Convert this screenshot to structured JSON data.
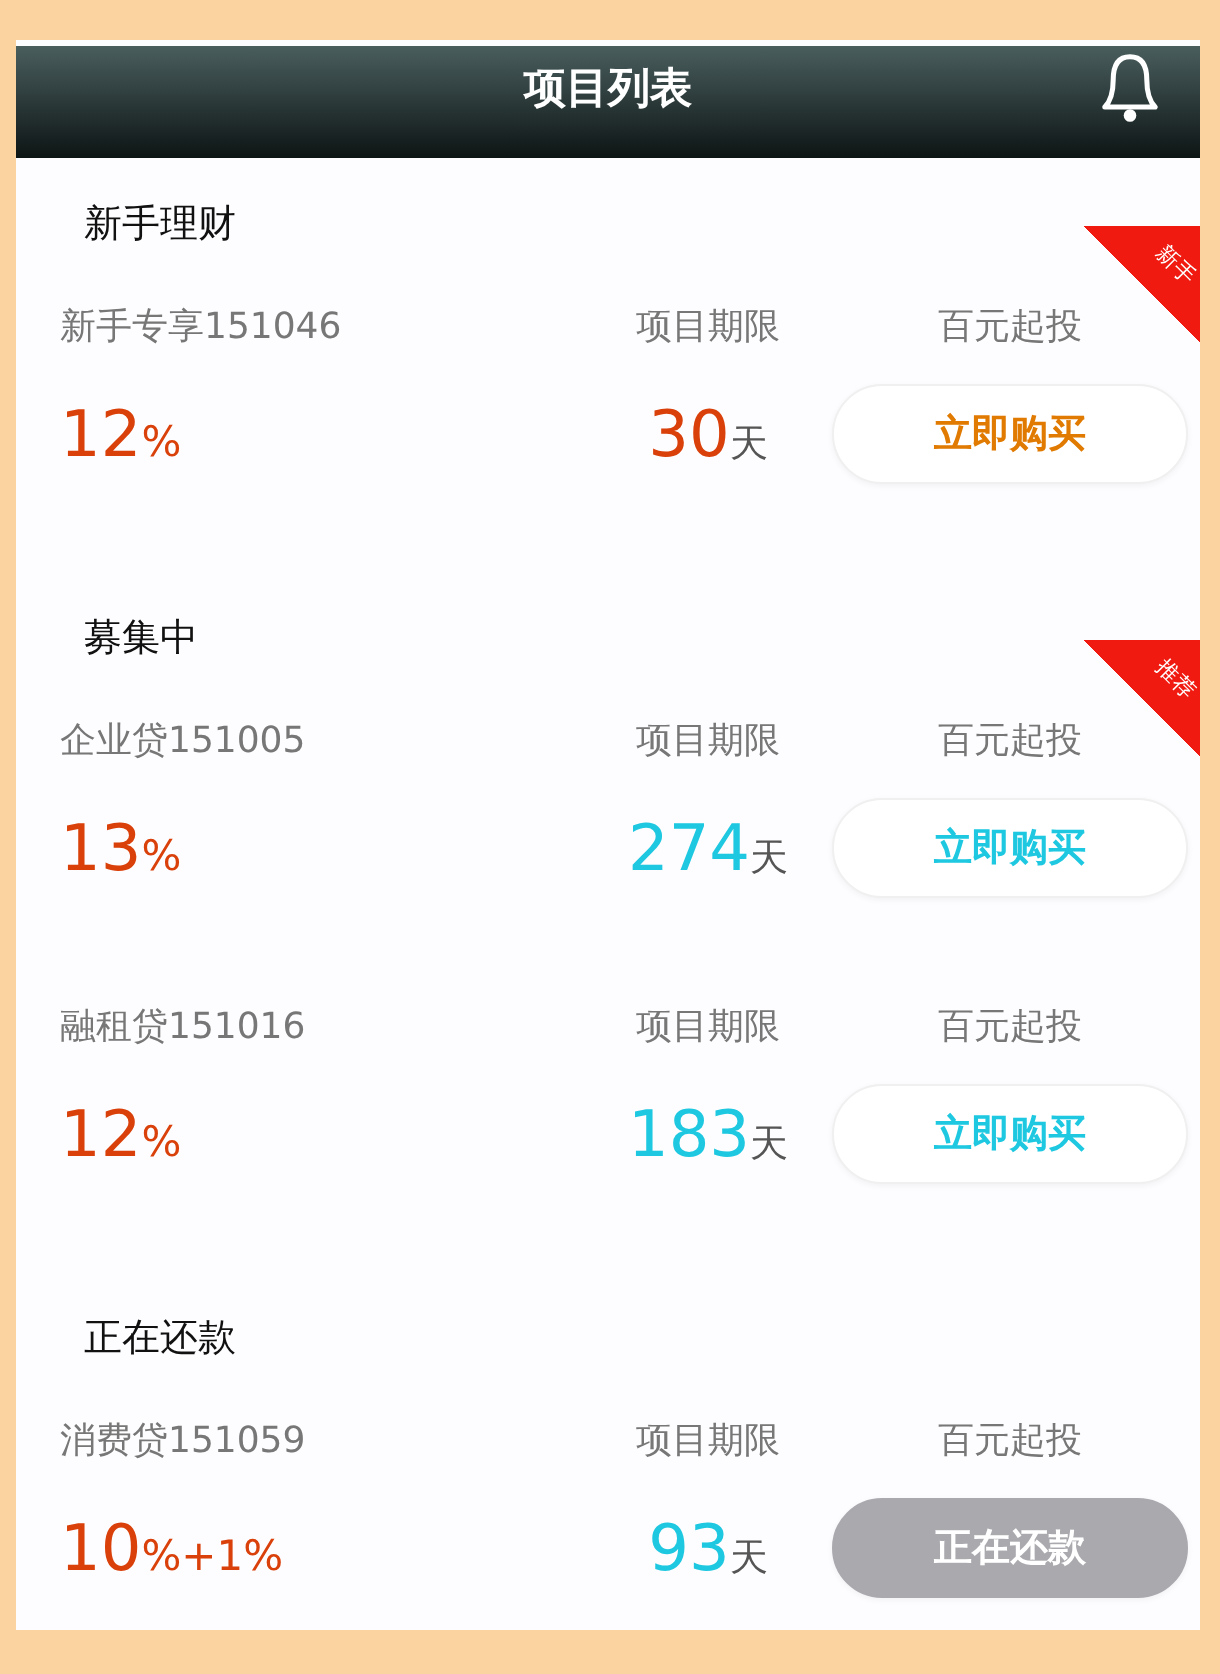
{
  "header": {
    "title": "项目列表"
  },
  "sections": [
    {
      "title": "新手理财",
      "items": [
        {
          "kind": "newbie",
          "name": "新手专享151046",
          "term_label": "项目期限",
          "min_label": "百元起投",
          "rate": "12",
          "rate_unit": "%",
          "days": "30",
          "days_unit": "天",
          "button": "立即购买",
          "disabled": false,
          "ribbon": "新手"
        }
      ]
    },
    {
      "title": "募集中",
      "items": [
        {
          "kind": "normal",
          "name": "企业贷151005",
          "term_label": "项目期限",
          "min_label": "百元起投",
          "rate": "13",
          "rate_unit": "%",
          "days": "274",
          "days_unit": "天",
          "button": "立即购买",
          "disabled": false,
          "ribbon": "推荐"
        },
        {
          "kind": "normal",
          "name": "融租贷151016",
          "term_label": "项目期限",
          "min_label": "百元起投",
          "rate": "12",
          "rate_unit": "%",
          "days": "183",
          "days_unit": "天",
          "button": "立即购买",
          "disabled": false
        }
      ]
    },
    {
      "title": "正在还款",
      "items": [
        {
          "kind": "normal",
          "name": "消费贷151059",
          "term_label": "项目期限",
          "min_label": "百元起投",
          "rate": "10",
          "rate_unit": "%+1%",
          "days": "93",
          "days_unit": "天",
          "button": "正在还款",
          "disabled": true
        }
      ]
    }
  ]
}
